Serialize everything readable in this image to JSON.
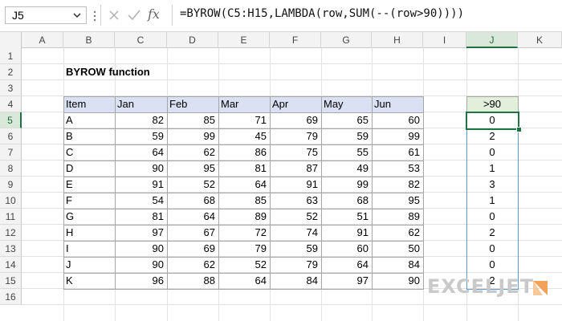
{
  "formula_bar": {
    "name_box": "J5",
    "formula": "=BYROW(C5:H15,LAMBDA(row,SUM(--(row>90))))"
  },
  "columns": [
    "A",
    "B",
    "C",
    "D",
    "E",
    "F",
    "G",
    "H",
    "I",
    "J",
    "K"
  ],
  "rows": [
    "1",
    "2",
    "3",
    "4",
    "5",
    "6",
    "7",
    "8",
    "9",
    "10",
    "11",
    "12",
    "13",
    "14",
    "15",
    "16"
  ],
  "sheet": {
    "title": "BYROW function",
    "table": {
      "headers": [
        "Item",
        "Jan",
        "Feb",
        "Mar",
        "Apr",
        "May",
        "Jun"
      ],
      "rows": [
        [
          "A",
          "82",
          "85",
          "71",
          "69",
          "65",
          "60"
        ],
        [
          "B",
          "59",
          "99",
          "45",
          "79",
          "59",
          "99"
        ],
        [
          "C",
          "64",
          "62",
          "86",
          "75",
          "55",
          "61"
        ],
        [
          "D",
          "90",
          "95",
          "81",
          "87",
          "49",
          "53"
        ],
        [
          "E",
          "91",
          "52",
          "64",
          "91",
          "99",
          "82"
        ],
        [
          "F",
          "54",
          "68",
          "85",
          "63",
          "68",
          "95"
        ],
        [
          "G",
          "81",
          "64",
          "89",
          "52",
          "51",
          "89"
        ],
        [
          "H",
          "97",
          "67",
          "72",
          "74",
          "91",
          "62"
        ],
        [
          "I",
          "90",
          "69",
          "79",
          "59",
          "60",
          "50"
        ],
        [
          "J",
          "90",
          "62",
          "52",
          "79",
          "64",
          "84"
        ],
        [
          "K",
          "96",
          "88",
          "64",
          "84",
          "97",
          "90"
        ]
      ]
    },
    "result": {
      "header": ">90",
      "values": [
        "0",
        "2",
        "0",
        "1",
        "3",
        "1",
        "0",
        "2",
        "0",
        "0",
        "2"
      ]
    }
  },
  "logo": {
    "text": "EXCELJET"
  },
  "colors": {
    "excel_green": "#217346",
    "table_header": "#d9e1f2",
    "result_header": "#e2efda",
    "spill_border": "#5b9bd5",
    "logo_orange": "#f0a15a"
  },
  "icons": {
    "cancel": "cancel-x-icon",
    "enter": "enter-check-icon",
    "fx": "insert-function-icon",
    "dropdown": "chevron-down-icon"
  }
}
